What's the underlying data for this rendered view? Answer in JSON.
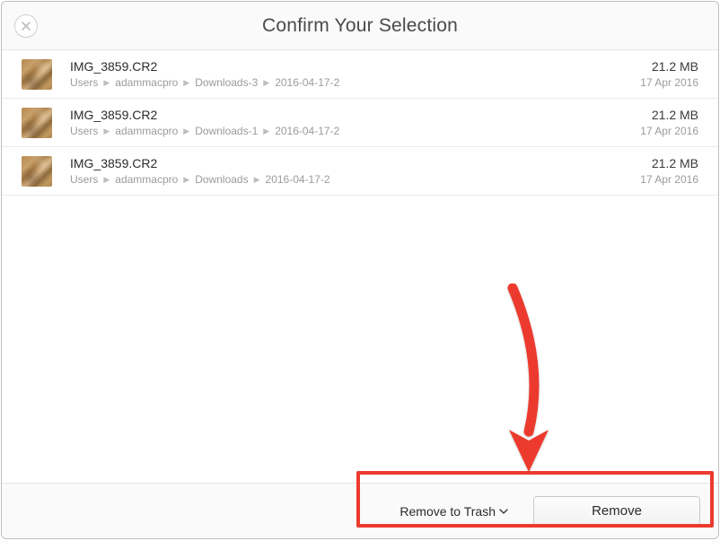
{
  "header": {
    "title": "Confirm Your Selection"
  },
  "items": [
    {
      "filename": "IMG_3859.CR2",
      "path": [
        "Users",
        "adammacpro",
        "Downloads-3",
        "2016-04-17-2"
      ],
      "size": "21.2 MB",
      "date": "17 Apr 2016"
    },
    {
      "filename": "IMG_3859.CR2",
      "path": [
        "Users",
        "adammacpro",
        "Downloads-1",
        "2016-04-17-2"
      ],
      "size": "21.2 MB",
      "date": "17 Apr 2016"
    },
    {
      "filename": "IMG_3859.CR2",
      "path": [
        "Users",
        "adammacpro",
        "Downloads",
        "2016-04-17-2"
      ],
      "size": "21.2 MB",
      "date": "17 Apr 2016"
    }
  ],
  "footer": {
    "mode_label": "Remove to Trash",
    "remove_label": "Remove"
  }
}
